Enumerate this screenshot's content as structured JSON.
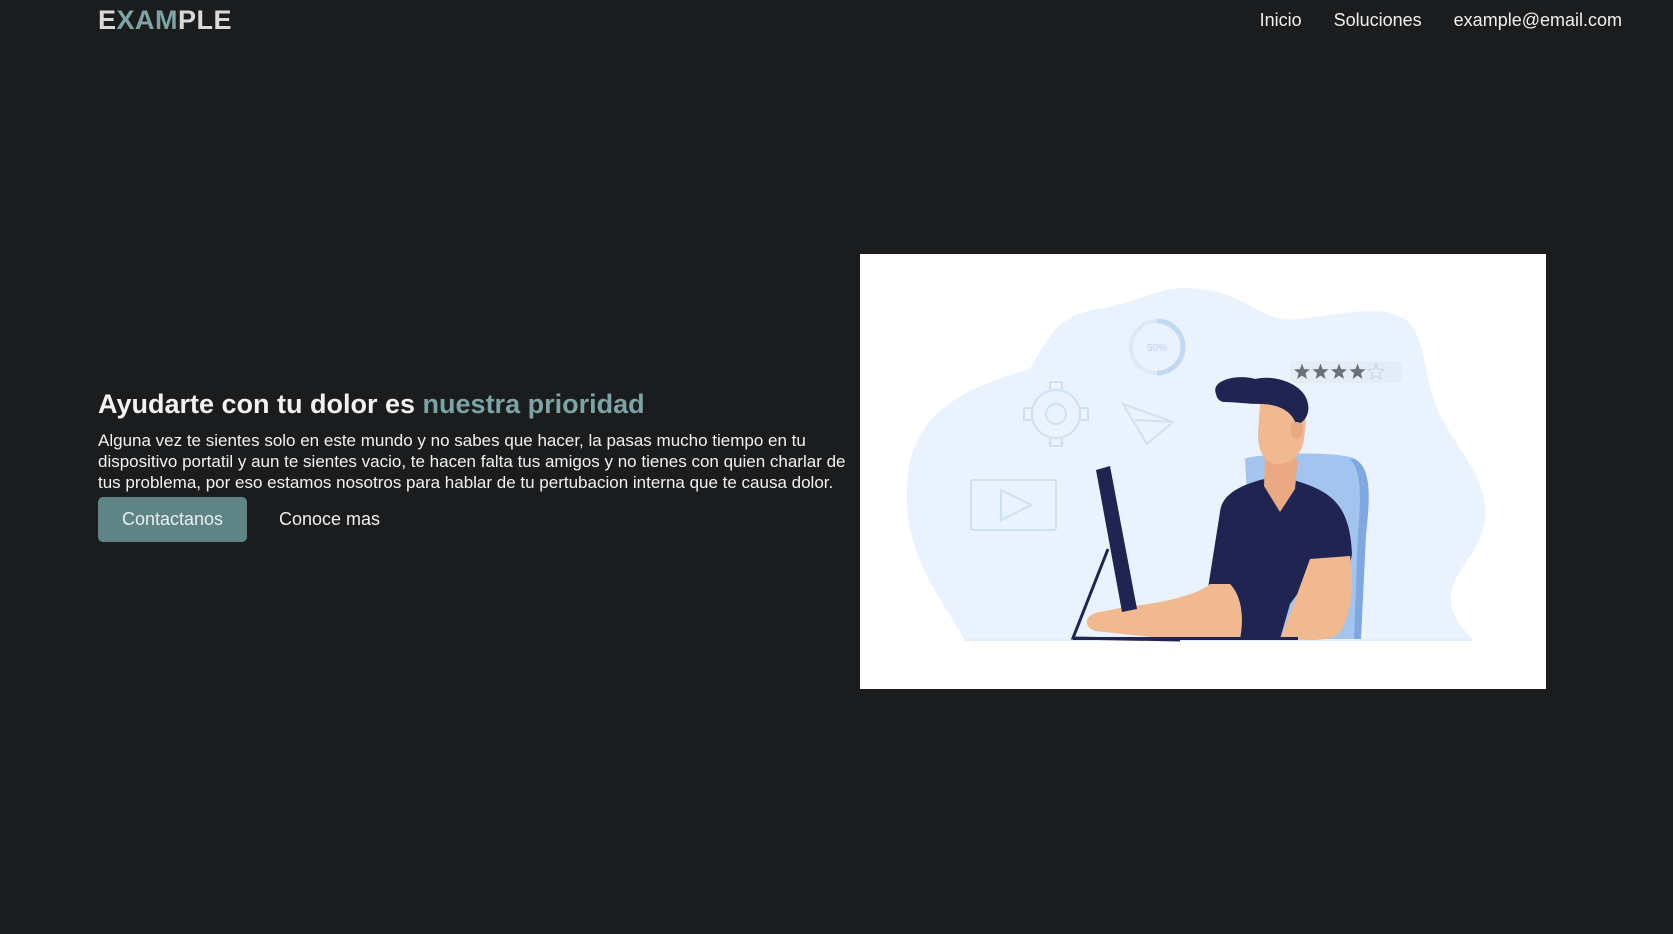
{
  "header": {
    "logo": {
      "part1": "E",
      "part2": "XAM",
      "part3": "PLE"
    },
    "nav": [
      {
        "label": "Inicio"
      },
      {
        "label": "Soluciones"
      },
      {
        "label": "example@email.com"
      }
    ]
  },
  "hero": {
    "title_main": "Ayudarte con tu dolor es ",
    "title_highlight": "nuestra prioridad",
    "body": "Alguna vez te sientes solo en este mundo y no sabes que hacer, la pasas mucho tiempo en tu dispositivo portatil y aun te sientes vacio, te hacen falta tus amigos y no tienes con quien charlar de tus problema, por eso estamos nosotros para hablar de tu pertubacion interna que te causa dolor.",
    "primary_button": "Contactanos",
    "secondary_button": "Conoce mas"
  },
  "illustration": {
    "progress_label": "50%",
    "rating": 4,
    "rating_max": 5,
    "colors": {
      "blob": "#e9f2fd",
      "navy": "#1f2550",
      "chair": "#a3c4ef",
      "skin": "#f0b990",
      "outline": "#cfe0f3",
      "star": "#6b6f77"
    }
  },
  "theme": {
    "background": "#1b1c1e",
    "accent": "#7ea3a4",
    "button": "#5f8485"
  }
}
